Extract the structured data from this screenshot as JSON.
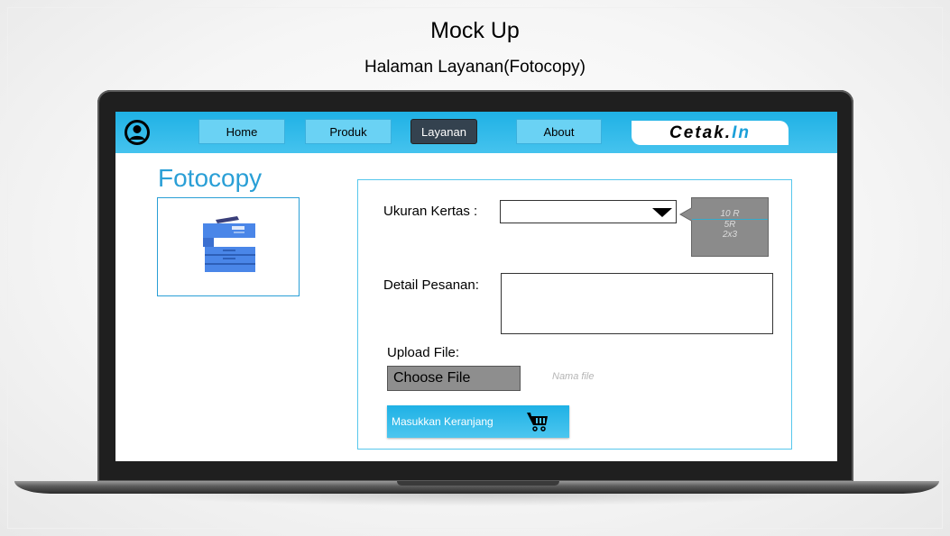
{
  "header": {
    "title": "Mock Up",
    "subtitle": "Halaman Layanan(Fotocopy)"
  },
  "nav": {
    "items": [
      {
        "label": "Home"
      },
      {
        "label": "Produk"
      },
      {
        "label": "Layanan",
        "active": true
      },
      {
        "label": "About"
      }
    ],
    "brand_part1": "Cetak.",
    "brand_part2": "In"
  },
  "page": {
    "title": "Fotocopy",
    "product_icon": "photocopier-icon"
  },
  "form": {
    "paper_size_label": "Ukuran Kertas :",
    "paper_size_value": "",
    "paper_size_options": [
      "10 R",
      "5R",
      "2x3"
    ],
    "order_detail_label": "Detail Pesanan:",
    "order_detail_value": "",
    "upload_label": "Upload File:",
    "choose_file_label": "Choose File",
    "file_name_placeholder": "Nama file",
    "add_to_cart_label": "Masukkan Keranjang"
  },
  "colors": {
    "accent": "#1fb1e5",
    "nav_button": "#6ad2f4",
    "active_button": "#34424f",
    "title_blue": "#2a9fd6"
  }
}
